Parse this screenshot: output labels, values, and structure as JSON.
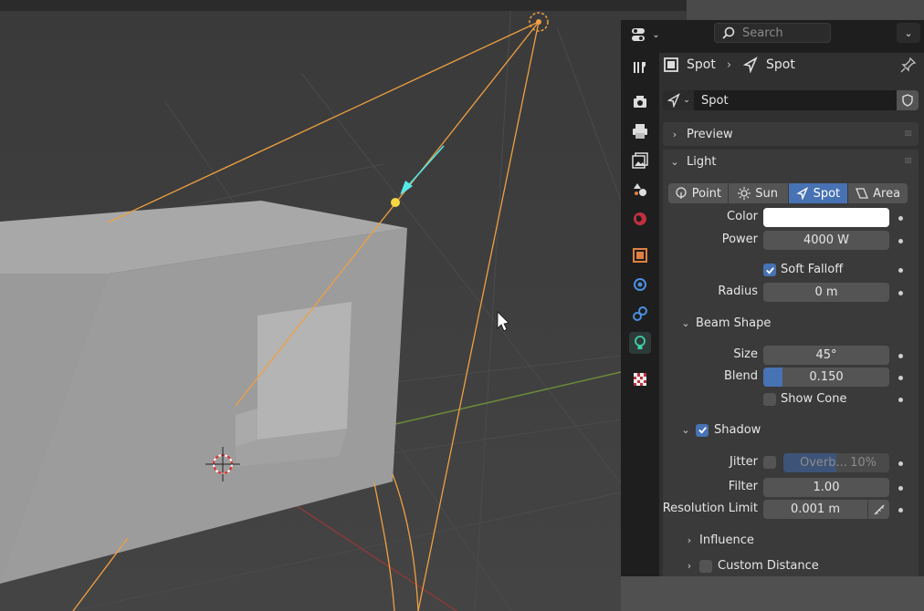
{
  "header": {
    "search_placeholder": "Search",
    "editor_type_icon": "properties-editor-icon"
  },
  "tabs": [
    {
      "name": "tool-tab",
      "icon": "wrench-screwdriver-icon"
    },
    {
      "name": "render-tab",
      "icon": "camera-back-icon"
    },
    {
      "name": "output-tab",
      "icon": "printer-icon"
    },
    {
      "name": "view-layer-tab",
      "icon": "image-stack-icon"
    },
    {
      "name": "scene-tab",
      "icon": "scene-icon"
    },
    {
      "name": "world-tab",
      "icon": "world-icon"
    },
    {
      "name": "object-tab",
      "icon": "object-square-icon"
    },
    {
      "name": "physics-tab",
      "icon": "physics-icon"
    },
    {
      "name": "constraints-tab",
      "icon": "constraint-icon"
    },
    {
      "name": "object-data-tab",
      "icon": "lightbulb-icon",
      "active": true
    },
    {
      "name": "texture-tab",
      "icon": "checker-icon"
    }
  ],
  "breadcrumb": {
    "object_name": "Spot",
    "data_name": "Spot"
  },
  "datablock": {
    "name": "Spot"
  },
  "panels": {
    "preview_label": "Preview",
    "light_label": "Light"
  },
  "light_types": [
    {
      "label": "Point",
      "icon": "point-light-icon",
      "active": false
    },
    {
      "label": "Sun",
      "icon": "sun-light-icon",
      "active": false
    },
    {
      "label": "Spot",
      "icon": "spot-light-icon",
      "active": true
    },
    {
      "label": "Area",
      "icon": "area-light-icon",
      "active": false
    }
  ],
  "light": {
    "color_label": "Color",
    "color_value": "#ffffff",
    "power_label": "Power",
    "power_value": "4000 W",
    "soft_falloff_label": "Soft Falloff",
    "soft_falloff": true,
    "radius_label": "Radius",
    "radius_value": "0 m"
  },
  "beam_shape": {
    "title": "Beam Shape",
    "size_label": "Size",
    "size_value": "45°",
    "blend_label": "Blend",
    "blend_value": "0.150",
    "blend_fraction": 0.15,
    "show_cone_label": "Show Cone",
    "show_cone": false
  },
  "shadow": {
    "title": "Shadow",
    "enabled": true,
    "jitter_label": "Jitter",
    "jitter_field_label": "Overb...",
    "jitter_field_value": "10%",
    "jitter_fraction": 0.1,
    "filter_label": "Filter",
    "filter_value": "1.00",
    "resolution_limit_label": "Resolution Limit",
    "resolution_limit_value": "0.001 m"
  },
  "collapsed": {
    "influence_label": "Influence",
    "custom_distance_label": "Custom Distance"
  },
  "colors": {
    "accent": "#4772b3",
    "light_lines": "#f0a040",
    "light_target": "#56e8e8",
    "editor_bg": "#303030"
  }
}
